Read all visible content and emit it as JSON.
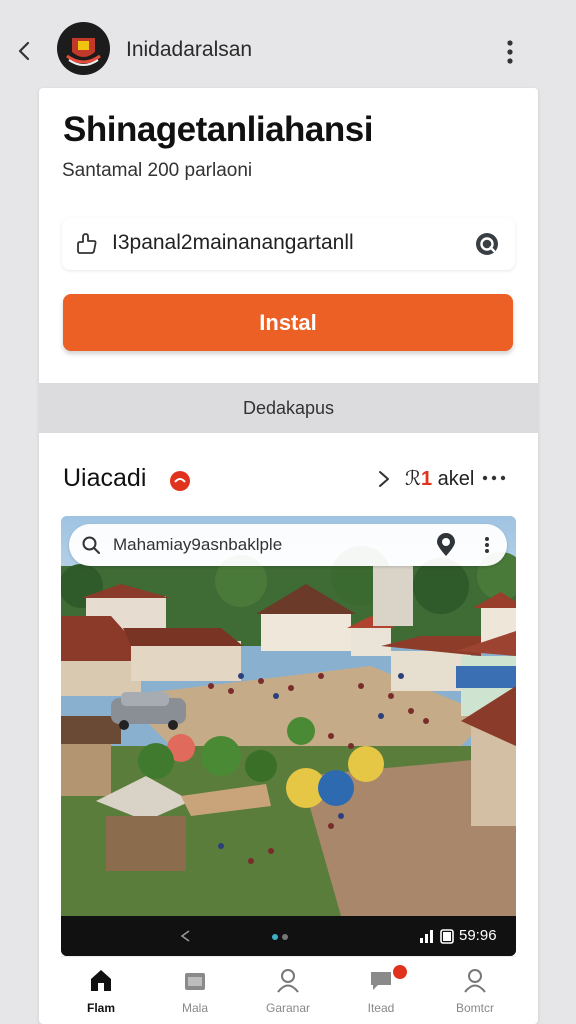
{
  "header": {
    "title": "Inidadaralsan",
    "back_icon": "chevron-left-icon",
    "menu_icon": "more-vertical-icon"
  },
  "app": {
    "name": "Shinagetanliahansi",
    "subtitle": "Santamal 200 parlaoni"
  },
  "field": {
    "value": "I3panal2mainanangartanll",
    "leading_icon": "share-icon",
    "trailing_icon": "lens-icon"
  },
  "install": {
    "label": "Instal"
  },
  "band": {
    "label": "Dedakapus"
  },
  "section": {
    "title": "Uiacadi",
    "count_prefix": "ℛ",
    "count_number": "1",
    "count_suffix": "akel"
  },
  "photo_search": {
    "text": "Mahamiay9asnbaklple",
    "pin_icon": "map-pin-icon",
    "more_icon": "more-vertical-icon"
  },
  "status_bar": {
    "time": "59:96"
  },
  "bottom_nav": {
    "items": [
      {
        "label": "Flam",
        "icon": "home-icon",
        "active": true
      },
      {
        "label": "Mala",
        "icon": "store-icon",
        "active": false
      },
      {
        "label": "Garanar",
        "icon": "person-icon",
        "active": false
      },
      {
        "label": "Itead",
        "icon": "message-icon",
        "active": false
      },
      {
        "label": "Bomtcr",
        "icon": "profile-icon",
        "active": false
      }
    ]
  },
  "colors": {
    "accent": "#ec5f25",
    "badge": "#e0331d",
    "background": "#e6e6e8"
  }
}
